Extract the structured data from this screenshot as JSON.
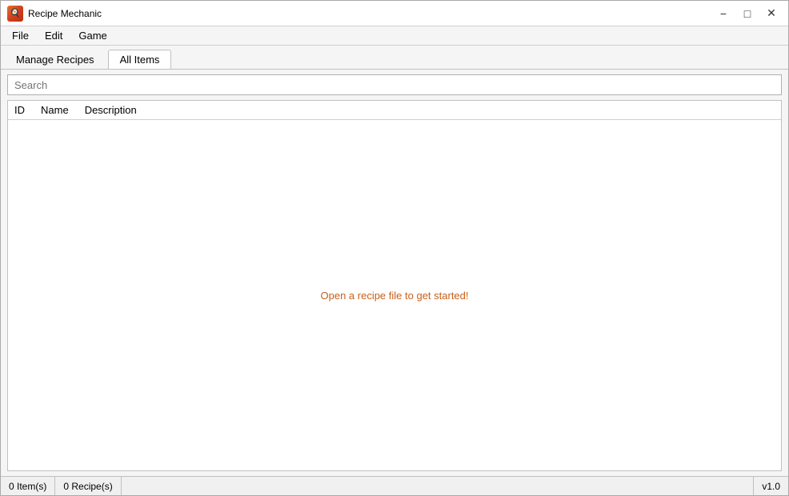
{
  "titleBar": {
    "title": "Recipe Mechanic",
    "minimize": "−",
    "maximize": "□",
    "close": "✕"
  },
  "menuBar": {
    "items": [
      {
        "label": "File"
      },
      {
        "label": "Edit"
      },
      {
        "label": "Game"
      }
    ]
  },
  "tabs": {
    "manageRecipes": "Manage Recipes",
    "allItems": "All Items"
  },
  "search": {
    "placeholder": "Search"
  },
  "table": {
    "columns": [
      {
        "label": "ID"
      },
      {
        "label": "Name"
      },
      {
        "label": "Description"
      }
    ],
    "emptyMessage": "Open a recipe file to get started!"
  },
  "statusBar": {
    "items": "0 Item(s)",
    "recipes": "0 Recipe(s)",
    "version": "v1.0"
  }
}
